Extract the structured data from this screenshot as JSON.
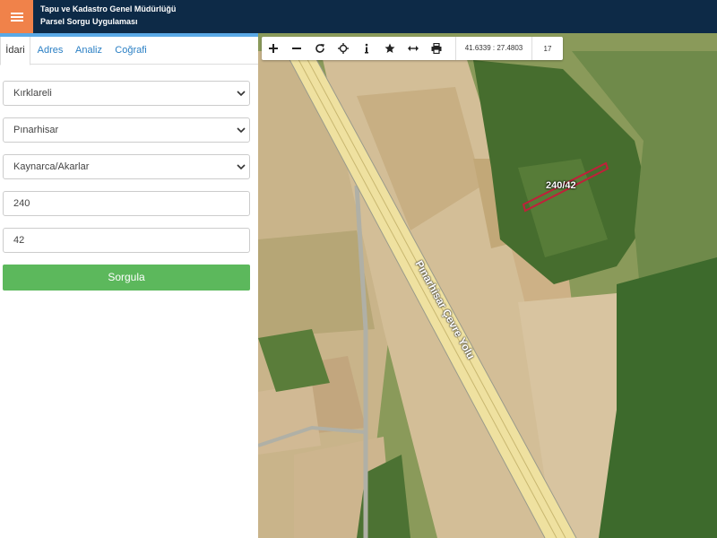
{
  "header": {
    "title_line1": "Tapu ve Kadastro Genel Müdürlüğü",
    "title_line2": "Parsel Sorgu Uygulaması",
    "menu_icon": "hamburger-icon",
    "colors": {
      "bar": "#0d2a47",
      "menu": "#f0824a"
    }
  },
  "sidebar": {
    "tabs": [
      {
        "label": "İdari",
        "active": true
      },
      {
        "label": "Adres",
        "active": false
      },
      {
        "label": "Analiz",
        "active": false
      },
      {
        "label": "Coğrafi",
        "active": false
      }
    ],
    "selects": {
      "province": "Kırklareli",
      "district": "Pınarhisar",
      "neighborhood": "Kaynarca/Akarlar"
    },
    "inputs": {
      "block": "240",
      "parcel": "42"
    },
    "query_button": "Sorgula",
    "accent_color": "#5cb85c"
  },
  "map": {
    "toolbar": {
      "tools": [
        "zoom-in-icon",
        "zoom-out-icon",
        "refresh-icon",
        "locate-icon",
        "info-icon",
        "favorite-icon",
        "measure-icon",
        "print-icon"
      ],
      "coordinates": "41.6339 : 27.4803",
      "zoom_level": "17"
    },
    "parcel_label": "240/42",
    "road_label": "Pınarhisar Çevre Yolu"
  }
}
